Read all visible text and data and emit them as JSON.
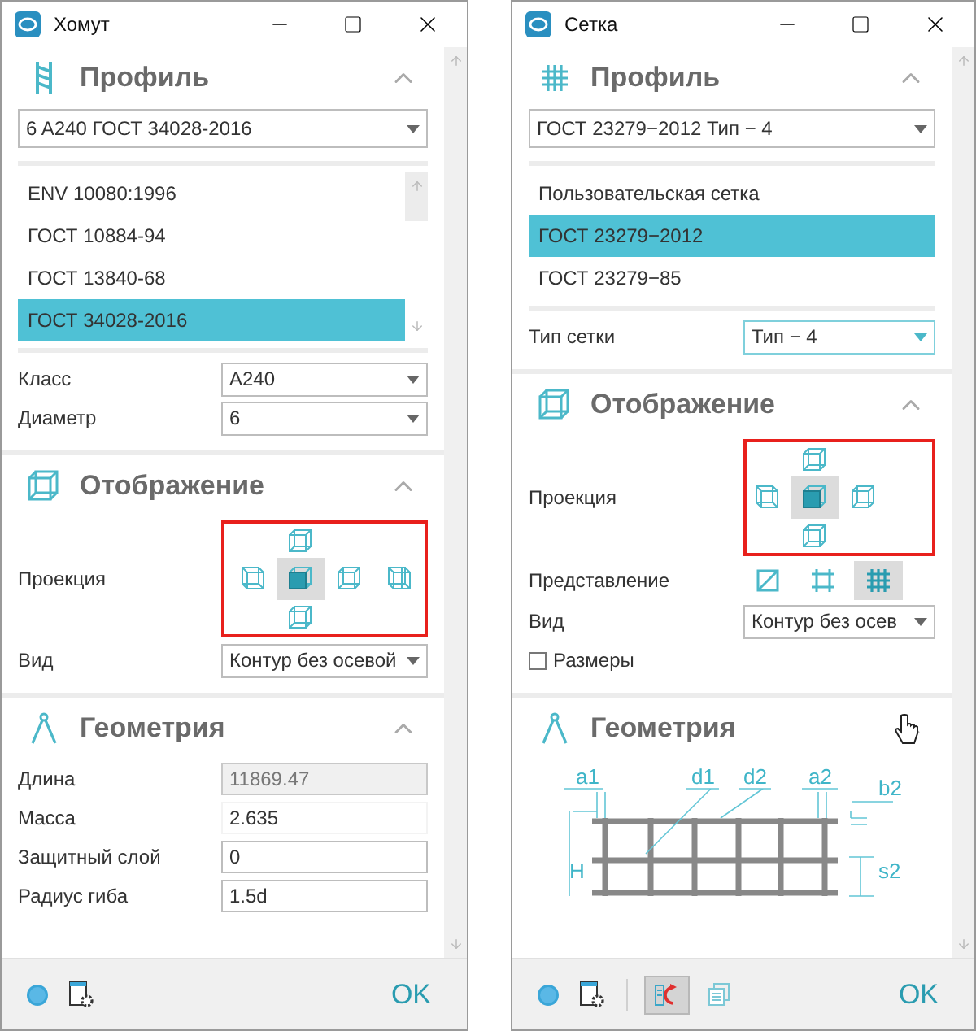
{
  "windows": [
    {
      "title": "Хомут",
      "sections": [
        {
          "kind": "rebar_profile",
          "title": "Профиль",
          "expanded": true,
          "combo": "6 A240 ГОСТ 34028-2016",
          "list": [
            {
              "label": "ENV 10080:1996",
              "selected": false
            },
            {
              "label": "ГОСТ 10884-94",
              "selected": false
            },
            {
              "label": "ГОСТ 13840-68",
              "selected": false
            },
            {
              "label": "ГОСТ 34028-2016",
              "selected": true
            }
          ],
          "list_scroll": true,
          "rows": [
            {
              "kind": "dropdown",
              "label": "Класс",
              "value": "A240",
              "focused": false
            },
            {
              "kind": "dropdown",
              "label": "Диаметр",
              "value": "6",
              "focused": false
            }
          ]
        },
        {
          "kind": "display",
          "title": "Отображение",
          "expanded": true,
          "rows": [
            {
              "kind": "projection",
              "label": "Проекция",
              "highlighted": true,
              "views": [
                {
                  "kind": "top",
                  "selected": false
                },
                {
                  "kind": "left",
                  "selected": false
                },
                {
                  "kind": "front",
                  "selected": true
                },
                {
                  "kind": "right",
                  "selected": false
                },
                {
                  "kind": "back",
                  "selected": false
                },
                {
                  "kind": "bottom",
                  "selected": false
                }
              ]
            },
            {
              "kind": "dropdown",
              "label": "Вид",
              "value": "Контур без осевой",
              "focused": false
            }
          ]
        },
        {
          "kind": "geometry",
          "title": "Геометрия",
          "expanded": true,
          "rows": [
            {
              "kind": "input",
              "label": "Длина",
              "value": "11869.47",
              "disabled": true
            },
            {
              "kind": "readonly",
              "label": "Масса",
              "value": "2.635"
            },
            {
              "kind": "input",
              "label": "Защитный слой",
              "value": "0",
              "disabled": false
            },
            {
              "kind": "input",
              "label": "Радиус гиба",
              "value": "1.5d",
              "disabled": false
            }
          ]
        }
      ],
      "footer": {
        "tools": [
          {
            "kind": "help",
            "selected": false
          },
          {
            "kind": "settings",
            "selected": false
          }
        ],
        "ok": "OK"
      }
    },
    {
      "title": "Сетка",
      "sections": [
        {
          "kind": "mesh_profile",
          "title": "Профиль",
          "expanded": true,
          "combo": "ГОСТ 23279−2012 Тип − 4",
          "list": [
            {
              "label": "Пользовательская сетка",
              "selected": false
            },
            {
              "label": "ГОСТ 23279−2012",
              "selected": true
            },
            {
              "label": "ГОСТ 23279−85",
              "selected": false
            }
          ],
          "list_scroll": false,
          "rows": [
            {
              "kind": "dropdown",
              "label": "Тип сетки",
              "value": "Тип − 4",
              "focused": true
            }
          ]
        },
        {
          "kind": "display",
          "title": "Отображение",
          "expanded": true,
          "rows": [
            {
              "kind": "projection",
              "label": "Проекция",
              "highlighted": true,
              "views": [
                {
                  "kind": "top",
                  "selected": false
                },
                {
                  "kind": "left",
                  "selected": false
                },
                {
                  "kind": "front",
                  "selected": true
                },
                {
                  "kind": "right",
                  "selected": false
                },
                {
                  "kind": "bottom",
                  "selected": false
                }
              ]
            },
            {
              "kind": "representation",
              "label": "Представление",
              "options": [
                {
                  "kind": "solid",
                  "selected": false
                },
                {
                  "kind": "frame",
                  "selected": false
                },
                {
                  "kind": "mesh",
                  "selected": true
                }
              ]
            },
            {
              "kind": "dropdown",
              "label": "Вид",
              "value": "Контур без осев",
              "focused": false
            },
            {
              "kind": "checkbox",
              "label": "Размеры",
              "checked": false
            }
          ]
        },
        {
          "kind": "geometry",
          "title": "Геометрия",
          "expanded": true,
          "rows": [
            {
              "kind": "drawing",
              "labels": [
                "a1",
                "d1",
                "d2",
                "a2",
                "b2",
                "H",
                "s2"
              ]
            }
          ]
        }
      ],
      "footer": {
        "tools": [
          {
            "kind": "help",
            "selected": false
          },
          {
            "kind": "settings",
            "selected": false
          },
          {
            "kind": "separator",
            "selected": false
          },
          {
            "kind": "reverse",
            "selected": true
          },
          {
            "kind": "copy",
            "selected": false
          }
        ],
        "ok": "OK"
      }
    }
  ]
}
